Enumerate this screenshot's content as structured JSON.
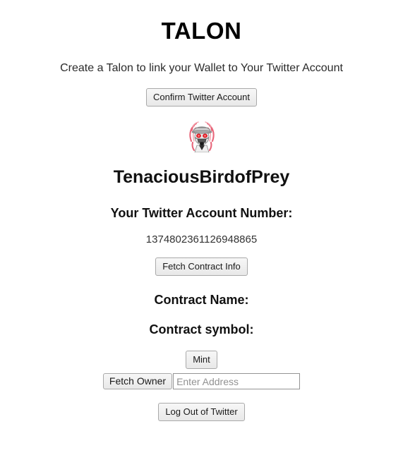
{
  "app": {
    "title": "TALON",
    "subtitle": "Create a Talon to link your Wallet to Your Twitter Account"
  },
  "actions": {
    "confirm_twitter_account": "Confirm Twitter Account",
    "fetch_contract_info": "Fetch Contract Info",
    "mint": "Mint",
    "fetch_owner": "Fetch Owner",
    "log_out_of_twitter": "Log Out of Twitter"
  },
  "profile": {
    "avatar_icon": "twitter-avatar-gasmask-character",
    "username": "TenaciousBirdofPrey",
    "account_number_label": "Your Twitter Account Number:",
    "account_number": "1374802361126948865"
  },
  "contract": {
    "name_label": "Contract Name:",
    "name_value": "",
    "symbol_label": "Contract symbol:",
    "symbol_value": ""
  },
  "owner_form": {
    "address_value": "",
    "address_placeholder": "Enter Address"
  },
  "colors": {
    "page_background": "#ffffff",
    "text": "#000000",
    "muted_text": "#333333",
    "button_face": "#efefef",
    "button_border": "#a9a9a9",
    "input_border": "#949494",
    "placeholder": "#919191",
    "avatar_accent": "#e8667a",
    "avatar_eye": "#e01b24"
  }
}
